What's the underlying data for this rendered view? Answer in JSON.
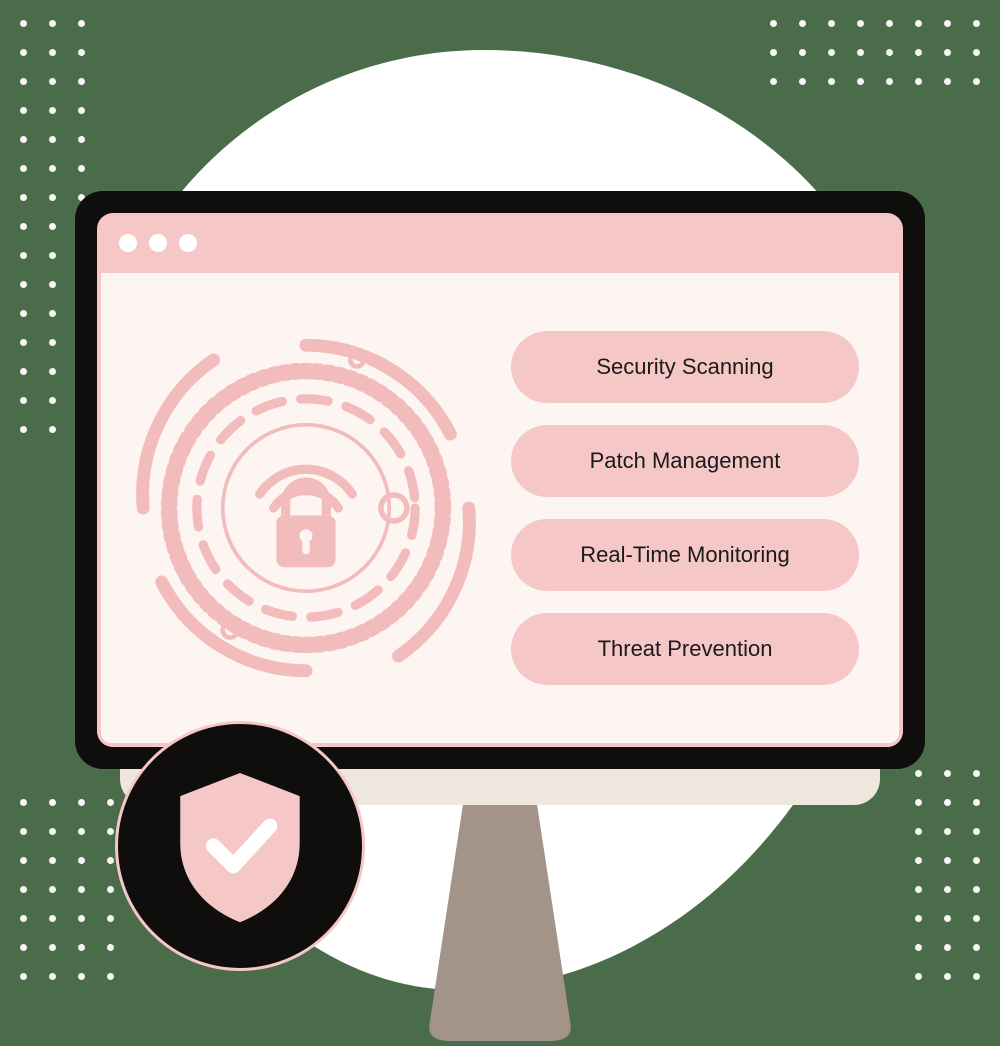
{
  "features": [
    {
      "label": "Security Scanning"
    },
    {
      "label": "Patch Management"
    },
    {
      "label": "Real-Time Monitoring"
    },
    {
      "label": "Threat Prevention"
    }
  ],
  "icons": {
    "radar_lock": "lock-radar-icon",
    "badge_shield": "shield-check-icon",
    "traffic_light": "window-traffic-light-icon"
  },
  "palette": {
    "background": "#4b6c4a",
    "primary_pink": "#f6c7c7",
    "dark": "#0f0e0d",
    "cream": "#efe6de"
  }
}
